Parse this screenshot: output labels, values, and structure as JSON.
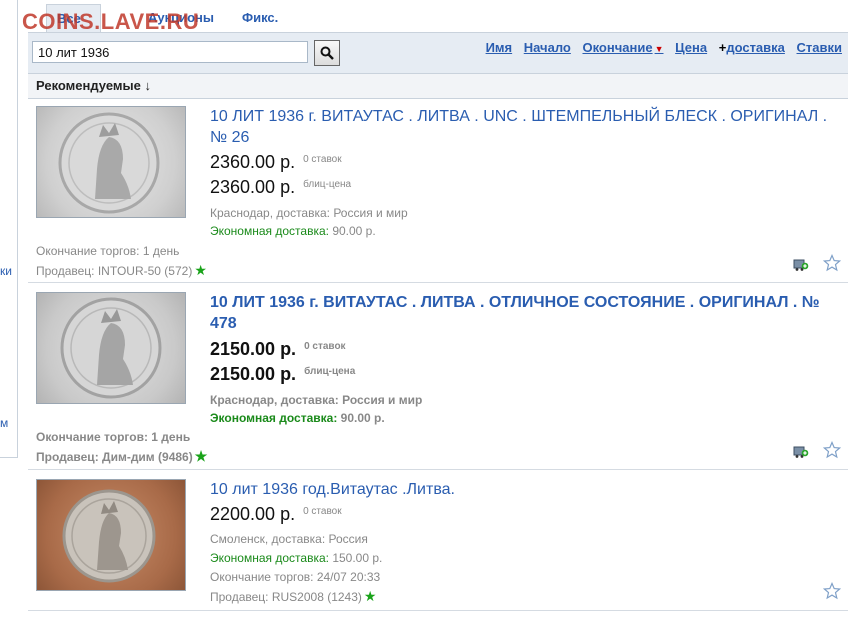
{
  "watermark": "COINS.LAVE.RU",
  "left_fragments": [
    "ки",
    "м"
  ],
  "tabs": [
    "Все лоты",
    "Аукционы",
    "Фикс."
  ],
  "search": {
    "value": "10 лит 1936"
  },
  "sort": {
    "name": "Имя",
    "start": "Начало",
    "end": "Окончание",
    "price": "Цена",
    "plus": "+",
    "delivery": "доставка",
    "bids": "Ставки"
  },
  "recommended": "Рекомендуемые ↓",
  "colors": {
    "link": "#2a5db0",
    "green": "#1a8a1a",
    "bar_bg": "#e6ecf3"
  },
  "listings": [
    {
      "title": "10 ЛИТ 1936 г. ВИТАУТАС . ЛИТВА . UNC . ШТЕМПЕЛЬНЫЙ БЛЕСК . ОРИГИНАЛ . № 26",
      "price": "2360.00 р.",
      "price_note": "0 ставок",
      "blitz": "2360.00 р.",
      "blitz_note": "блиц-цена",
      "location": "Краснодар, доставка: Россия и мир",
      "ship_label": "Экономная доставка:",
      "ship_value": " 90.00 р.",
      "end": "Окончание торгов: 1 день",
      "seller": "Продавец: INTOUR-50 (572)"
    },
    {
      "title": "10 ЛИТ 1936 г. ВИТАУТАС . ЛИТВА . ОТЛИЧНОЕ СОСТОЯНИЕ . ОРИГИНАЛ . № 478",
      "price": "2150.00 р.",
      "price_note": "0 ставок",
      "blitz": "2150.00 р.",
      "blitz_note": "блиц-цена",
      "location": "Краснодар, доставка: Россия и мир",
      "ship_label": "Экономная доставка:",
      "ship_value": " 90.00 р.",
      "end": "Окончание торгов: 1 день",
      "seller": "Продавец: Дим-дим (9486)"
    },
    {
      "title": "10 лит 1936 год.Витаутас .Литва.",
      "price": "2200.00 р.",
      "price_note": "0 ставок",
      "location": "Смоленск, доставка: Россия",
      "ship_label": "Экономная доставка:",
      "ship_value": " 150.00 р.",
      "end": "Окончание торгов: 24/07 20:33",
      "seller": "Продавец: RUS2008 (1243)"
    }
  ]
}
